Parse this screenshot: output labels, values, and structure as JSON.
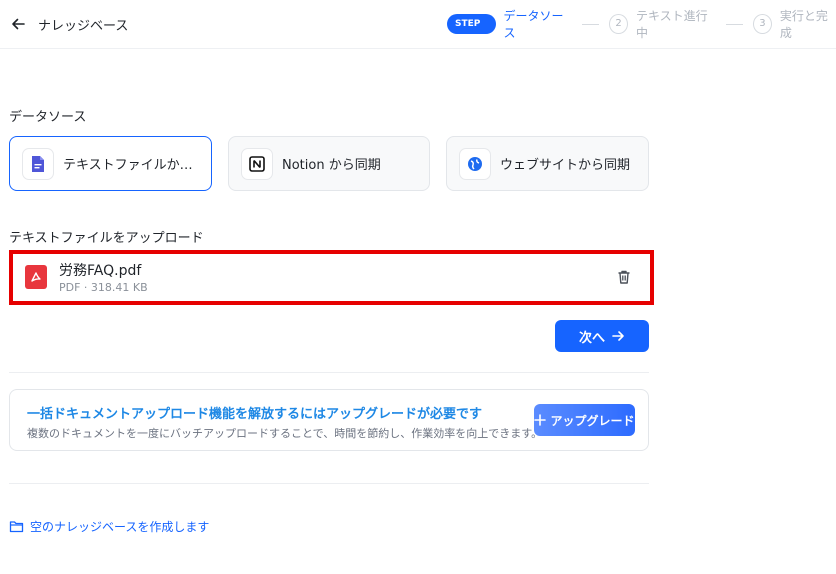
{
  "header": {
    "back_icon": "arrow-left-icon",
    "title": "ナレッジベース",
    "steps": [
      {
        "badge": "STEP 1",
        "label": "データソース",
        "active": true
      },
      {
        "number": "2",
        "label": "テキスト進行中",
        "active": false
      },
      {
        "number": "3",
        "label": "実行と完成",
        "active": false
      }
    ]
  },
  "data_source": {
    "title": "データソース",
    "options": [
      {
        "label": "テキストファイルからイン...",
        "icon": "document-icon",
        "selected": true
      },
      {
        "label": "Notion から同期",
        "icon": "notion-icon",
        "selected": false
      },
      {
        "label": "ウェブサイトから同期",
        "icon": "globe-icon",
        "selected": false
      }
    ]
  },
  "upload": {
    "title": "テキストファイルをアップロード",
    "file": {
      "name": "労務FAQ.pdf",
      "meta": "PDF · 318.41 KB",
      "icon": "pdf-icon"
    },
    "delete_icon": "trash-icon"
  },
  "next_button": {
    "label": "次へ",
    "icon": "arrow-right-icon"
  },
  "upgrade": {
    "title": "一括ドキュメントアップロード機能を解放するにはアップグレードが必要です",
    "description": "複数のドキュメントを一度にバッチアップロードすることで、時間を節約し、作業効率を向上できます。",
    "button_label": "アップグレード",
    "button_icon": "sparkle-icon"
  },
  "empty_kb_link": {
    "label": "空のナレッジベースを作成します",
    "icon": "folder-icon"
  },
  "colors": {
    "accent": "#1664ff",
    "highlight_border": "#e60000",
    "pdf_red": "#e8363d"
  }
}
